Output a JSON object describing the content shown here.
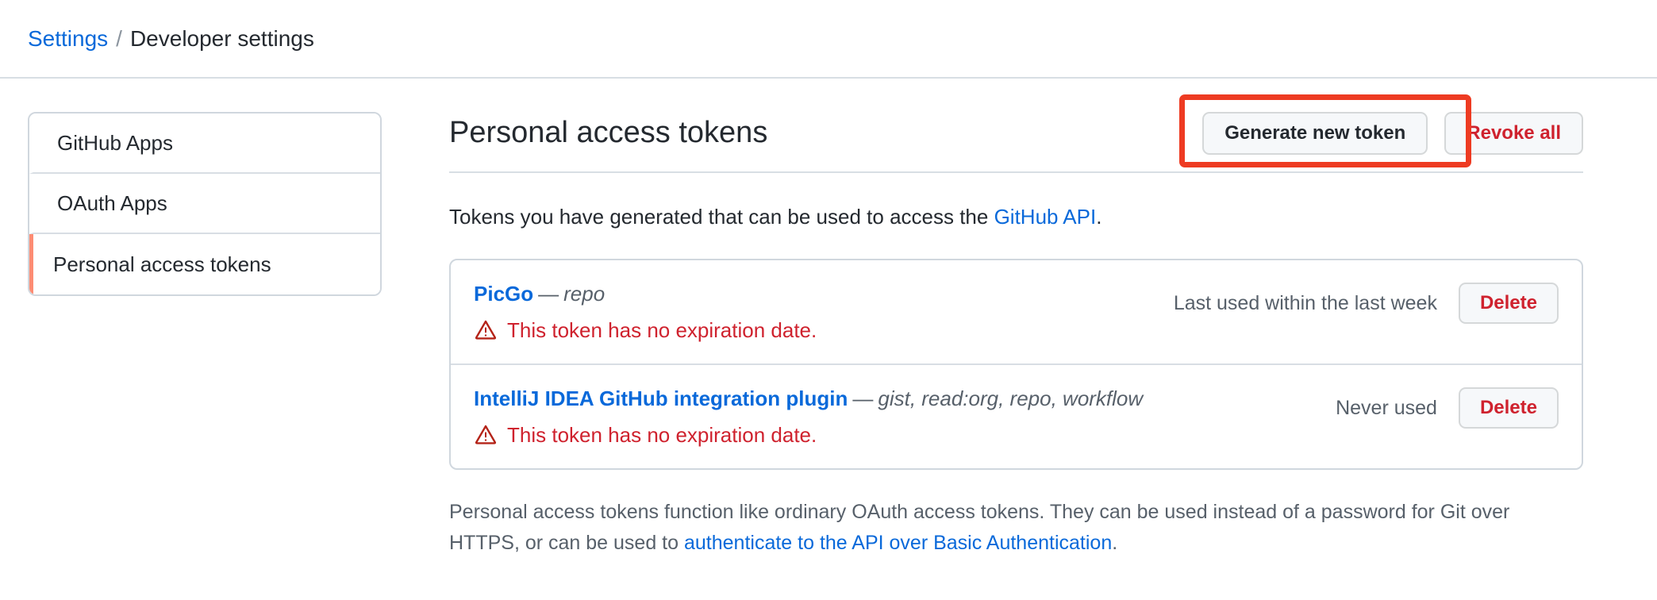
{
  "breadcrumb": {
    "parent": "Settings",
    "separator": "/",
    "current": "Developer settings"
  },
  "sidebar": {
    "items": [
      {
        "label": "GitHub Apps",
        "selected": false
      },
      {
        "label": "OAuth Apps",
        "selected": false
      },
      {
        "label": "Personal access tokens",
        "selected": true
      }
    ],
    "selected_indicator_color": "#fd8c73"
  },
  "main": {
    "title": "Personal access tokens",
    "actions": {
      "generate_label": "Generate new token",
      "revoke_label": "Revoke all",
      "highlight_color": "#ee3b22",
      "highlight_target": "Generate new token"
    },
    "intro": {
      "text_before": "Tokens you have generated that can be used to access the ",
      "link": "GitHub API",
      "text_after": "."
    },
    "tokens": [
      {
        "name": "PicGo",
        "dash": "—",
        "scopes": "repo",
        "warning": "This token has no expiration date.",
        "warning_icon": "warning-triangle-icon",
        "last_used": "Last used within the last week",
        "delete_label": "Delete"
      },
      {
        "name": "IntelliJ IDEA GitHub integration plugin",
        "dash": "—",
        "scopes": "gist, read:org, repo, workflow",
        "warning": "This token has no expiration date.",
        "warning_icon": "warning-triangle-icon",
        "last_used": "Never used",
        "delete_label": "Delete"
      }
    ],
    "footer": {
      "text_before": "Personal access tokens function like ordinary OAuth access tokens. They can be used instead of a password for Git over HTTPS, or can be used to ",
      "link": "authenticate to the API over Basic Authentication",
      "text_after": "."
    }
  },
  "colors": {
    "link": "#0969da",
    "danger": "#cf222e",
    "border": "#d0d7de",
    "muted": "#57606a",
    "button_bg": "#f6f8fa"
  }
}
